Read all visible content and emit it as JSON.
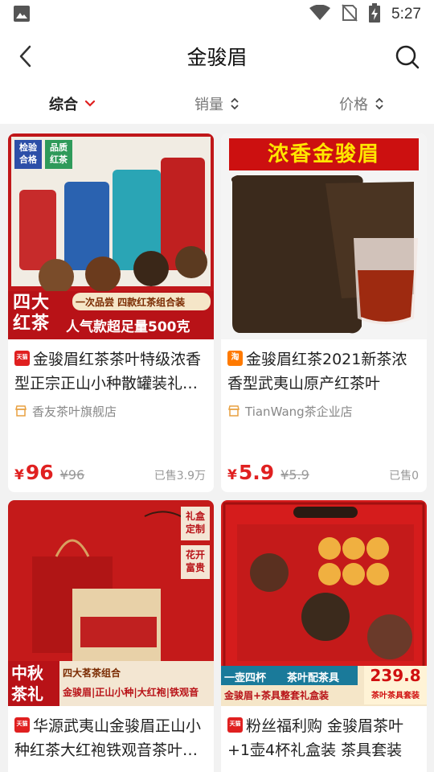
{
  "status_bar": {
    "time": "5:27"
  },
  "header": {
    "title": "金骏眉"
  },
  "sort": {
    "items": [
      {
        "label": "综合",
        "active": true
      },
      {
        "label": "销量",
        "active": false
      },
      {
        "label": "价格",
        "active": false
      }
    ]
  },
  "products": [
    {
      "badge": "天猫",
      "title": "金骏眉红茶茶叶特级浓香型正宗正山小种散罐装礼盒装",
      "shop": "香友茶叶旗舰店",
      "price_symbol": "¥",
      "price": "96",
      "original_price": "¥96",
      "sold": "已售3.9万",
      "img_text": {
        "badge1a": "检验",
        "badge1b": "合格",
        "badge2a": "品质",
        "badge2b": "红茶",
        "banner_big": "四大红茶",
        "banner_small": "一次品尝 四款红茶组合装",
        "banner_main": "人气款超足量500克"
      }
    },
    {
      "badge": "淘",
      "title": "金骏眉红茶2021新茶浓香型武夷山原产红茶叶",
      "shop": "TianWang茶企业店",
      "price_symbol": "¥",
      "price": "5.9",
      "original_price": "¥5.9",
      "sold": "已售0",
      "img_text": {
        "banner": "浓香金骏眉"
      }
    },
    {
      "badge": "天猫",
      "title": "华源武夷山金骏眉正山小种红茶大红袍铁观音茶叶礼盒",
      "shop": "",
      "price_symbol": "",
      "price": "",
      "original_price": "",
      "sold": "",
      "img_text": {
        "tag1": "礼盒定制",
        "tag2": "花开富贵",
        "big": "中秋茶礼",
        "combo": "四大茗茶组合",
        "names": "金骏眉|正山小种|大红袍|铁观音"
      }
    },
    {
      "badge": "天猫",
      "title": "粉丝福利购 金骏眉茶叶+1壶4杯礼盒装 茶具套装",
      "shop": "",
      "price_symbol": "",
      "price": "",
      "original_price": "",
      "sold": "",
      "img_text": {
        "left": "一壶四杯",
        "right": "茶叶配茶具",
        "price_tag": "239.8",
        "price_sub": "茶叶茶具套装",
        "bottom": "金骏眉+茶具整套礼盒装"
      }
    }
  ],
  "colors": {
    "accent": "#e02020",
    "background": "#f2f2f2"
  }
}
